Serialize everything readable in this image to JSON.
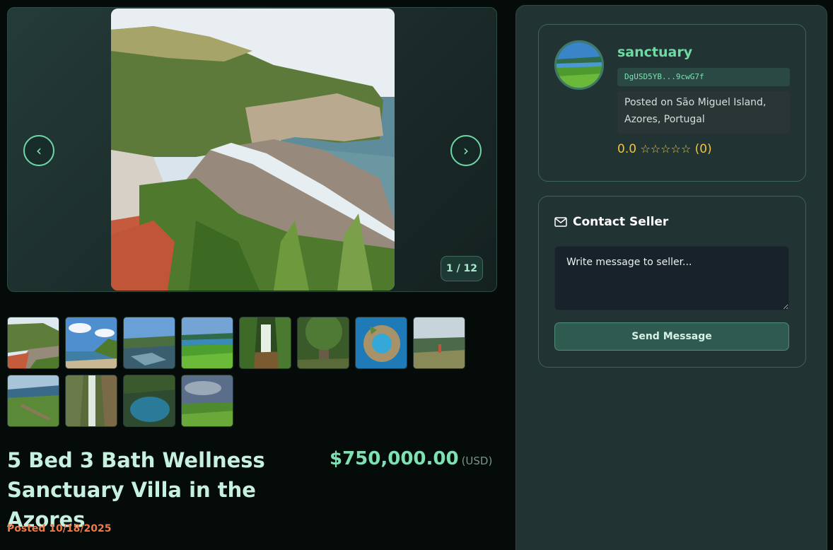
{
  "gallery": {
    "prev_symbol": "‹",
    "next_symbol": "›",
    "counter": "1 / 12",
    "thumbnails": [
      "coast-cliff-beach",
      "green-coast-sky",
      "tide-pools-coast",
      "green-crater-lake",
      "forest-waterfall",
      "giant-tree-forest",
      "islet-lagoon-aerial",
      "hiker-viewpoint",
      "coastal-farmland",
      "canyon-waterfall",
      "blue-lagoon-pool",
      "green-field-clouds"
    ]
  },
  "listing": {
    "title": "5 Bed 3 Bath Wellness Sanctuary Villa in the Azores",
    "price": "$750,000.00",
    "currency": "(USD)",
    "posted": "Posted 10/18/2025"
  },
  "seller": {
    "name": "sanctuary",
    "wallet": "DgUSD5YB...9cwG7f",
    "location": "Posted on São Miguel Island, Azores, Portugal",
    "rating_value": "0.0",
    "rating_stars": "☆☆☆☆☆",
    "rating_count": "(0)"
  },
  "contact": {
    "title": "Contact Seller",
    "message_placeholder": "Write message to seller...",
    "send_label": "Send Message"
  },
  "colors": {
    "accent": "#6fdaa3",
    "price": "#7ee0b3",
    "date": "#ee7a4a",
    "rating": "#f3c437"
  }
}
